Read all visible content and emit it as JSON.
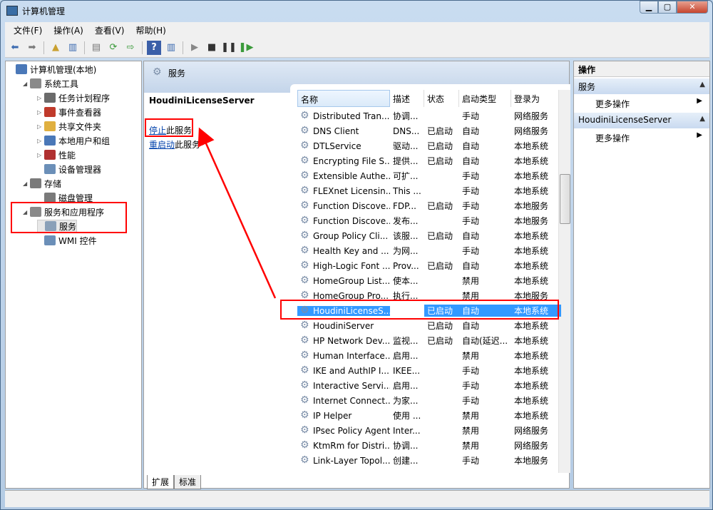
{
  "window": {
    "title": "计算机管理",
    "min": "▁",
    "max": "▢",
    "close": "✕"
  },
  "menu": [
    "文件(F)",
    "操作(A)",
    "查看(V)",
    "帮助(H)"
  ],
  "tree": [
    {
      "label": "计算机管理(本地)",
      "level": 0,
      "toggle": "",
      "color": "#4a78b8"
    },
    {
      "label": "系统工具",
      "level": 1,
      "toggle": "◢",
      "color": "#8a8a8a"
    },
    {
      "label": "任务计划程序",
      "level": 2,
      "toggle": "▷",
      "color": "#6b6b6b"
    },
    {
      "label": "事件查看器",
      "level": 2,
      "toggle": "▷",
      "color": "#c03a2b"
    },
    {
      "label": "共享文件夹",
      "level": 2,
      "toggle": "▷",
      "color": "#e0b040"
    },
    {
      "label": "本地用户和组",
      "level": 2,
      "toggle": "▷",
      "color": "#4a78b8"
    },
    {
      "label": "性能",
      "level": 2,
      "toggle": "▷",
      "color": "#b03030"
    },
    {
      "label": "设备管理器",
      "level": 2,
      "toggle": "",
      "color": "#6b8fb8"
    },
    {
      "label": "存储",
      "level": 1,
      "toggle": "◢",
      "color": "#7a7a7a"
    },
    {
      "label": "磁盘管理",
      "level": 2,
      "toggle": "",
      "color": "#7a7a7a"
    },
    {
      "label": "服务和应用程序",
      "level": 1,
      "toggle": "◢",
      "color": "#8a8a8a"
    },
    {
      "label": "服务",
      "level": 2,
      "toggle": "",
      "color": "#8aa0b8"
    },
    {
      "label": "WMI 控件",
      "level": 2,
      "toggle": "",
      "color": "#6b8fb8"
    }
  ],
  "center": {
    "header": "服务",
    "selected_service": "HoudiniLicenseServer",
    "stop_link": "停止",
    "stop_suffix": "此服务",
    "restart_link": "重启动",
    "restart_suffix": "此服务",
    "columns": [
      "名称",
      "描述",
      "状态",
      "启动类型",
      "登录为"
    ],
    "rows": [
      [
        "Distributed Tran...",
        "协调...",
        "",
        "手动",
        "网络服务"
      ],
      [
        "DNS Client",
        "DNS...",
        "已启动",
        "自动",
        "网络服务"
      ],
      [
        "DTLService",
        "驱动...",
        "已启动",
        "自动",
        "本地系统"
      ],
      [
        "Encrypting File S...",
        "提供...",
        "已启动",
        "自动",
        "本地系统"
      ],
      [
        "Extensible Authe...",
        "可扩...",
        "",
        "手动",
        "本地系统"
      ],
      [
        "FLEXnet Licensin...",
        "This ...",
        "",
        "手动",
        "本地系统"
      ],
      [
        "Function Discove...",
        "FDP...",
        "已启动",
        "手动",
        "本地服务"
      ],
      [
        "Function Discove...",
        "发布...",
        "",
        "手动",
        "本地服务"
      ],
      [
        "Group Policy Cli...",
        "该服...",
        "已启动",
        "自动",
        "本地系统"
      ],
      [
        "Health Key and ...",
        "为网...",
        "",
        "手动",
        "本地系统"
      ],
      [
        "High-Logic Font ...",
        "Prov...",
        "已启动",
        "自动",
        "本地系统"
      ],
      [
        "HomeGroup List...",
        "使本...",
        "",
        "禁用",
        "本地系统"
      ],
      [
        "HomeGroup Pro...",
        "执行...",
        "",
        "禁用",
        "本地服务"
      ],
      [
        "HoudiniLicenseS...",
        "",
        "已启动",
        "自动",
        "本地系统"
      ],
      [
        "HoudiniServer",
        "",
        "已启动",
        "自动",
        "本地系统"
      ],
      [
        "HP Network Dev...",
        "监视...",
        "已启动",
        "自动(延迟...",
        "本地系统"
      ],
      [
        "Human Interface...",
        "启用...",
        "",
        "禁用",
        "本地系统"
      ],
      [
        "IKE and AuthIP I...",
        "IKEE...",
        "",
        "手动",
        "本地系统"
      ],
      [
        "Interactive Servi...",
        "启用...",
        "",
        "手动",
        "本地系统"
      ],
      [
        "Internet Connect...",
        "为家...",
        "",
        "手动",
        "本地系统"
      ],
      [
        "IP Helper",
        "使用 ...",
        "",
        "禁用",
        "本地系统"
      ],
      [
        "IPsec Policy Agent",
        "Inter...",
        "",
        "禁用",
        "网络服务"
      ],
      [
        "KtmRm for Distri...",
        "协调...",
        "",
        "禁用",
        "网络服务"
      ],
      [
        "Link-Layer Topol...",
        "创建...",
        "",
        "手动",
        "本地服务"
      ]
    ],
    "selected_index": 13,
    "tabs": [
      "扩展",
      "标准"
    ]
  },
  "actions": {
    "title": "操作",
    "sections": [
      {
        "label": "服务",
        "item": "更多操作"
      },
      {
        "label": "HoudiniLicenseServer",
        "item": "更多操作"
      }
    ]
  },
  "annotation_color": "#ff0000"
}
